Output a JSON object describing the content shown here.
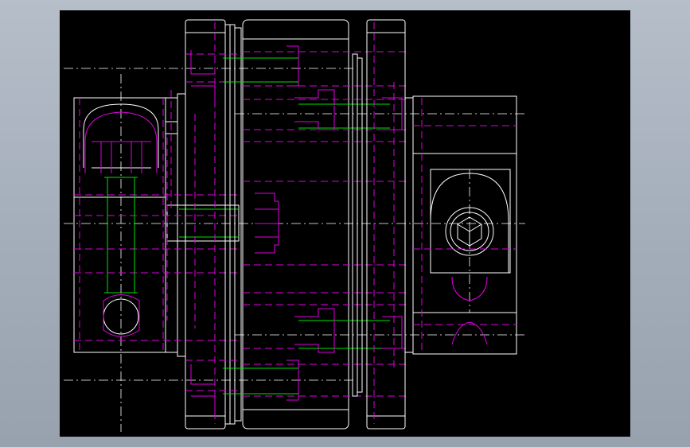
{
  "viewer": {
    "background_color": "#a5afbb",
    "canvas_color": "#000000"
  },
  "drawing": {
    "colors": {
      "outline": "#ffffff",
      "hidden_lines": "#e000e0",
      "thread_lines": "#00e000",
      "center_lines": "#ffffff"
    },
    "icons": [
      "hex-socket-icon"
    ]
  }
}
